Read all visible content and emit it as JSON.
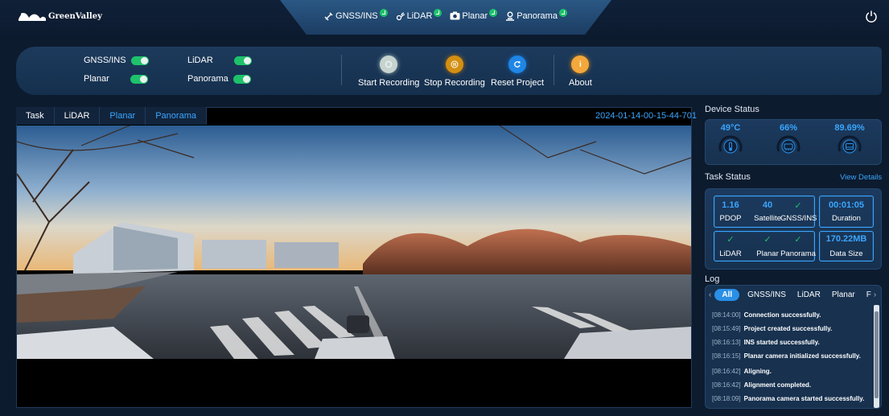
{
  "app": {
    "brand": "GreenValley"
  },
  "header": {
    "modules": [
      {
        "label": "GNSS/INS",
        "icon": "satellite-icon",
        "status": "ok"
      },
      {
        "label": "LiDAR",
        "icon": "lidar-icon",
        "status": "ok"
      },
      {
        "label": "Planar",
        "icon": "camera-icon",
        "status": "ok"
      },
      {
        "label": "Panorama",
        "icon": "panorama-icon",
        "status": "ok"
      }
    ]
  },
  "controls": {
    "toggles": [
      {
        "label": "GNSS/INS",
        "on": true
      },
      {
        "label": "Planar",
        "on": true
      },
      {
        "label": "LiDAR",
        "on": true
      },
      {
        "label": "Panorama",
        "on": true
      }
    ],
    "actions": [
      {
        "label": "Start Recording",
        "icon": "record-icon",
        "color": "#c7d3cf"
      },
      {
        "label": "Stop Recording",
        "icon": "pause-icon",
        "color": "#d38f12"
      },
      {
        "label": "Reset Project",
        "icon": "reset-icon",
        "color": "#1f86e6"
      },
      {
        "label": "About",
        "icon": "info-icon",
        "color": "#f4a73a"
      }
    ]
  },
  "viewer": {
    "tabs": [
      "Task",
      "LiDAR",
      "Planar",
      "Panorama"
    ],
    "timestamp": "2024-01-14-00-15-44-701"
  },
  "device_status": {
    "title": "Device Status",
    "gauges": [
      {
        "value": "49°C",
        "icon": "thermometer-icon"
      },
      {
        "value": "66%",
        "icon": "memory-icon"
      },
      {
        "value": "89.69%",
        "icon": "storage-icon"
      }
    ]
  },
  "task_status": {
    "title": "Task Status",
    "view_details": "View Details",
    "pdop": "1.16",
    "pdop_label": "PDOP",
    "satellite": "40",
    "satellite_label": "Satellite",
    "gnss_label": "GNSS/INS",
    "duration": "00:01:05",
    "duration_label": "Duration",
    "lidar_label": "LiDAR",
    "planar_label": "Planar",
    "panorama_label": "Panorama",
    "data_size": "170.22MB",
    "data_size_label": "Data Size",
    "check": "✓"
  },
  "log": {
    "title": "Log",
    "tabs": [
      "All",
      "GNSS/INS",
      "LiDAR",
      "Planar",
      "F"
    ],
    "entries": [
      {
        "time": "[08:14:00]",
        "msg": "Connection successfully."
      },
      {
        "time": "[08:15:49]",
        "msg": "Project created successfully."
      },
      {
        "time": "[08:16:13]",
        "msg": "INS started successfully."
      },
      {
        "time": "[08:16:15]",
        "msg": "Planar camera initialized successfully."
      },
      {
        "time": "[08:16:42]",
        "msg": "Aligning."
      },
      {
        "time": "[08:16:42]",
        "msg": "Alignment completed."
      },
      {
        "time": "[08:18:09]",
        "msg": "Panorama camera started successfully."
      }
    ]
  }
}
